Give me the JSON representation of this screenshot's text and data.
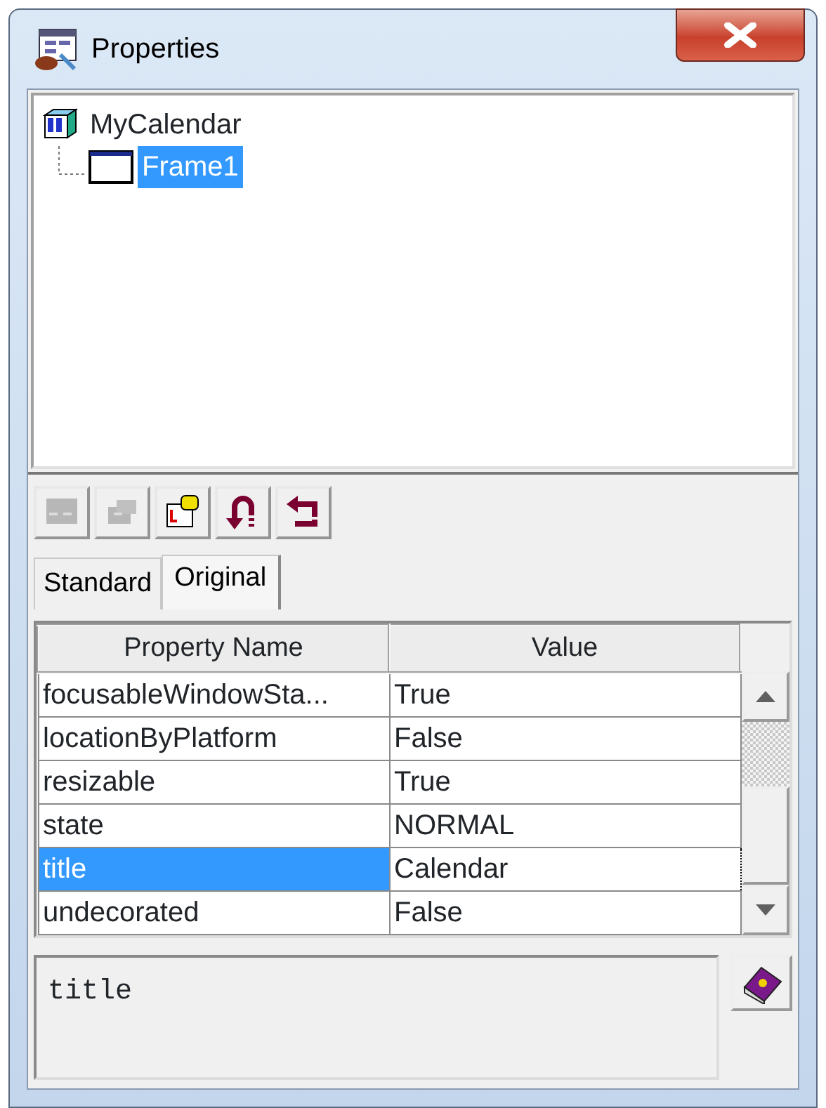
{
  "window": {
    "title": "Properties"
  },
  "tree": [
    {
      "label": "MyCalendar",
      "selected": false,
      "children": [
        {
          "label": "Frame1",
          "selected": true
        }
      ]
    }
  ],
  "toolbar": [
    {
      "kind": "window",
      "disabled": true
    },
    {
      "kind": "properties",
      "disabled": true
    },
    {
      "kind": "edit",
      "disabled": false
    },
    {
      "kind": "undo",
      "disabled": false
    },
    {
      "kind": "revert",
      "disabled": false
    }
  ],
  "tabs": [
    {
      "label": "Standard",
      "selected": false
    },
    {
      "label": "Original",
      "selected": true
    }
  ],
  "table": {
    "columns": [
      "Property Name",
      "Value"
    ],
    "rows": [
      {
        "name": "focusableWindowSta...",
        "value": "True",
        "selected": false
      },
      {
        "name": "locationByPlatform",
        "value": "False",
        "selected": false
      },
      {
        "name": "resizable",
        "value": "True",
        "selected": false
      },
      {
        "name": "state",
        "value": "NORMAL",
        "selected": false
      },
      {
        "name": "title",
        "value": "Calendar",
        "selected": true
      },
      {
        "name": "undecorated",
        "value": "False",
        "selected": false
      }
    ]
  },
  "description": "title"
}
